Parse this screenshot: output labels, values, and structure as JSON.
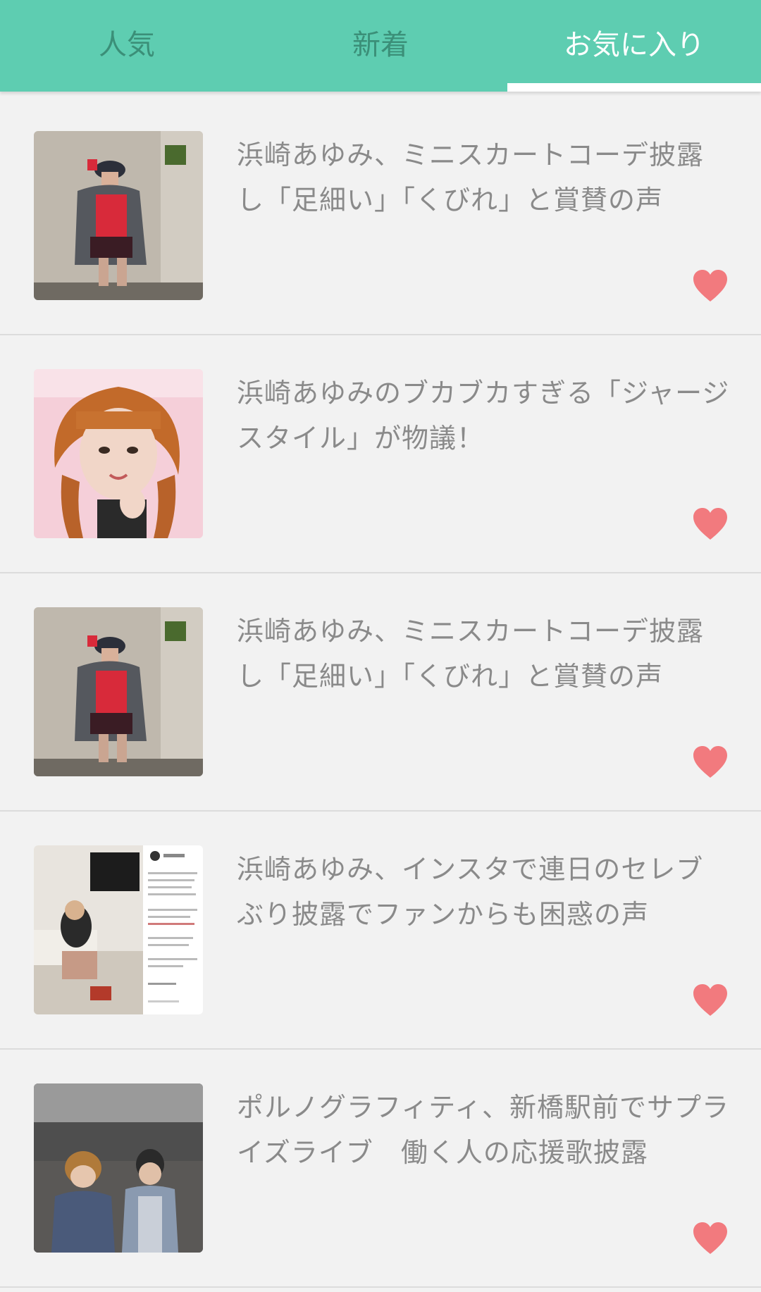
{
  "tabs": [
    {
      "label": "人気",
      "active": false
    },
    {
      "label": "新着",
      "active": false
    },
    {
      "label": "お気に入り",
      "active": true
    }
  ],
  "articles": [
    {
      "title": "浜崎あゆみ、ミニスカートコーデ披露し「足細い」「くびれ」と賞賛の声",
      "favorited": true,
      "thumb": "woman-red-top-skirt-photo"
    },
    {
      "title": "浜崎あゆみのブカブカすぎる「ジャージスタイル」が物議！",
      "favorited": true,
      "thumb": "woman-portrait-photo"
    },
    {
      "title": "浜崎あゆみ、ミニスカートコーデ披露し「足細い」「くびれ」と賞賛の声",
      "favorited": true,
      "thumb": "woman-red-top-skirt-photo"
    },
    {
      "title": "浜崎あゆみ、インスタで連日のセレブぶり披露でファンからも困惑の声",
      "favorited": true,
      "thumb": "instagram-post-screenshot"
    },
    {
      "title": "ポルノグラフィティ、新橋駅前でサプライズライブ　働く人の応援歌披露",
      "favorited": true,
      "thumb": "two-men-crowd-photo"
    }
  ],
  "colors": {
    "header_bg": "#5ecdb1",
    "tab_inactive": "#3b8f78",
    "tab_active": "#ffffff",
    "heart": "#f27a7e",
    "title_text": "#8a8a8a",
    "background": "#f2f2f2"
  }
}
